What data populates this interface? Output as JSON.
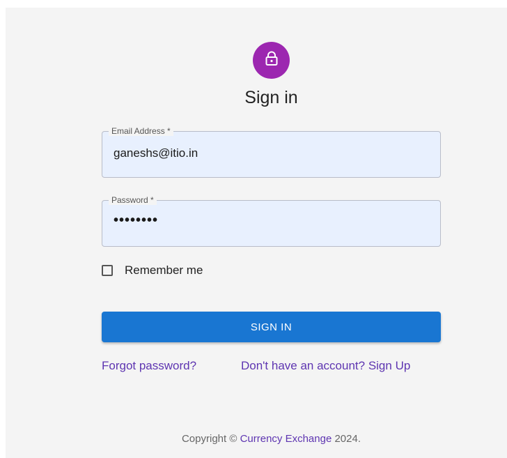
{
  "header": {
    "icon": "lock-icon",
    "avatar_color": "#9c27b0",
    "title": "Sign in"
  },
  "form": {
    "email": {
      "label": "Email Address *",
      "value": "ganeshs@itio.in"
    },
    "password": {
      "label": "Password *",
      "value": "••••••••"
    },
    "remember": {
      "label": "Remember me",
      "checked": false
    },
    "submit_label": "SIGN IN",
    "accent": "#1976d2"
  },
  "links": {
    "forgot": "Forgot password?",
    "signup": "Don't have an account? Sign Up",
    "link_color": "#5e35b1"
  },
  "footer": {
    "prefix": "Copyright © ",
    "company": "Currency Exchange",
    "suffix": " 2024."
  }
}
